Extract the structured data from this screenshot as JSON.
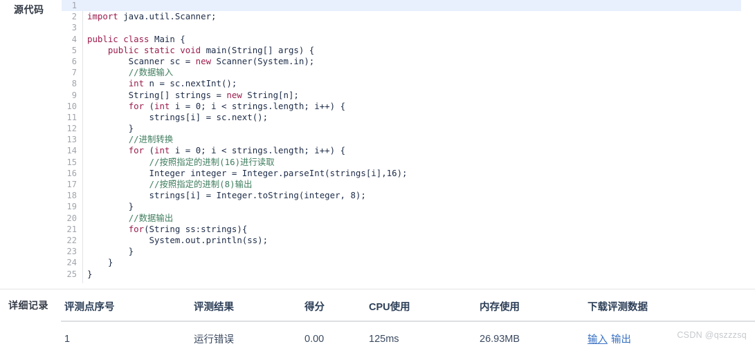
{
  "source": {
    "label": "源代码",
    "highlight_color": "#e8f0fd",
    "lines": [
      {
        "n": "1",
        "segments": []
      },
      {
        "n": "2",
        "segments": [
          {
            "t": "kw",
            "s": "import"
          },
          {
            "t": "pl",
            "s": " java.util.Scanner;"
          }
        ]
      },
      {
        "n": "3",
        "segments": []
      },
      {
        "n": "4",
        "segments": [
          {
            "t": "kw",
            "s": "public class"
          },
          {
            "t": "pl",
            "s": " Main {"
          }
        ]
      },
      {
        "n": "5",
        "segments": [
          {
            "t": "pl",
            "s": "    "
          },
          {
            "t": "kw",
            "s": "public static void"
          },
          {
            "t": "pl",
            "s": " main(String[] args) {"
          }
        ]
      },
      {
        "n": "6",
        "segments": [
          {
            "t": "pl",
            "s": "        Scanner sc = "
          },
          {
            "t": "kw",
            "s": "new"
          },
          {
            "t": "pl",
            "s": " Scanner(System.in);"
          }
        ]
      },
      {
        "n": "7",
        "segments": [
          {
            "t": "pl",
            "s": "        "
          },
          {
            "t": "cm",
            "s": "//数据输入"
          }
        ]
      },
      {
        "n": "8",
        "segments": [
          {
            "t": "pl",
            "s": "        "
          },
          {
            "t": "kw",
            "s": "int"
          },
          {
            "t": "pl",
            "s": " n = sc.nextInt();"
          }
        ]
      },
      {
        "n": "9",
        "segments": [
          {
            "t": "pl",
            "s": "        String[] strings = "
          },
          {
            "t": "kw",
            "s": "new"
          },
          {
            "t": "pl",
            "s": " String[n];"
          }
        ]
      },
      {
        "n": "10",
        "segments": [
          {
            "t": "pl",
            "s": "        "
          },
          {
            "t": "kw",
            "s": "for"
          },
          {
            "t": "pl",
            "s": " ("
          },
          {
            "t": "kw",
            "s": "int"
          },
          {
            "t": "pl",
            "s": " i = 0; i < strings.length; i++) {"
          }
        ]
      },
      {
        "n": "11",
        "segments": [
          {
            "t": "pl",
            "s": "            strings[i] = sc.next();"
          }
        ]
      },
      {
        "n": "12",
        "segments": [
          {
            "t": "pl",
            "s": "        }"
          }
        ]
      },
      {
        "n": "13",
        "segments": [
          {
            "t": "pl",
            "s": "        "
          },
          {
            "t": "cm",
            "s": "//进制转换"
          }
        ]
      },
      {
        "n": "14",
        "segments": [
          {
            "t": "pl",
            "s": "        "
          },
          {
            "t": "kw",
            "s": "for"
          },
          {
            "t": "pl",
            "s": " ("
          },
          {
            "t": "kw",
            "s": "int"
          },
          {
            "t": "pl",
            "s": " i = 0; i < strings.length; i++) {"
          }
        ]
      },
      {
        "n": "15",
        "segments": [
          {
            "t": "pl",
            "s": "            "
          },
          {
            "t": "cm",
            "s": "//按照指定的进制(16)进行读取"
          }
        ]
      },
      {
        "n": "16",
        "segments": [
          {
            "t": "pl",
            "s": "            Integer integer = Integer.parseInt(strings[i],16);"
          }
        ]
      },
      {
        "n": "17",
        "segments": [
          {
            "t": "pl",
            "s": "            "
          },
          {
            "t": "cm",
            "s": "//按照指定的进制(8)输出"
          }
        ]
      },
      {
        "n": "18",
        "segments": [
          {
            "t": "pl",
            "s": "            strings[i] = Integer.toString(integer, 8);"
          }
        ]
      },
      {
        "n": "19",
        "segments": [
          {
            "t": "pl",
            "s": "        }"
          }
        ]
      },
      {
        "n": "20",
        "segments": [
          {
            "t": "pl",
            "s": "        "
          },
          {
            "t": "cm",
            "s": "//数据输出"
          }
        ]
      },
      {
        "n": "21",
        "segments": [
          {
            "t": "pl",
            "s": "        "
          },
          {
            "t": "kw",
            "s": "for"
          },
          {
            "t": "pl",
            "s": "(String ss:strings){"
          }
        ]
      },
      {
        "n": "22",
        "segments": [
          {
            "t": "pl",
            "s": "            System.out.println(ss);"
          }
        ]
      },
      {
        "n": "23",
        "segments": [
          {
            "t": "pl",
            "s": "        }"
          }
        ]
      },
      {
        "n": "24",
        "segments": [
          {
            "t": "pl",
            "s": "    }"
          }
        ]
      },
      {
        "n": "25",
        "segments": [
          {
            "t": "pl",
            "s": "}"
          }
        ]
      }
    ]
  },
  "detail": {
    "label": "详细记录",
    "columns": [
      "评测点序号",
      "评测结果",
      "得分",
      "CPU使用",
      "内存使用",
      "下载评测数据"
    ],
    "rows": [
      {
        "index": "1",
        "result": "运行错误",
        "score": "0.00",
        "cpu": "125ms",
        "memory": "26.93MB",
        "download_input": "输入",
        "download_output": "输出"
      }
    ],
    "link_color": "#3a72c4"
  },
  "watermark": "CSDN @qszzzsq"
}
